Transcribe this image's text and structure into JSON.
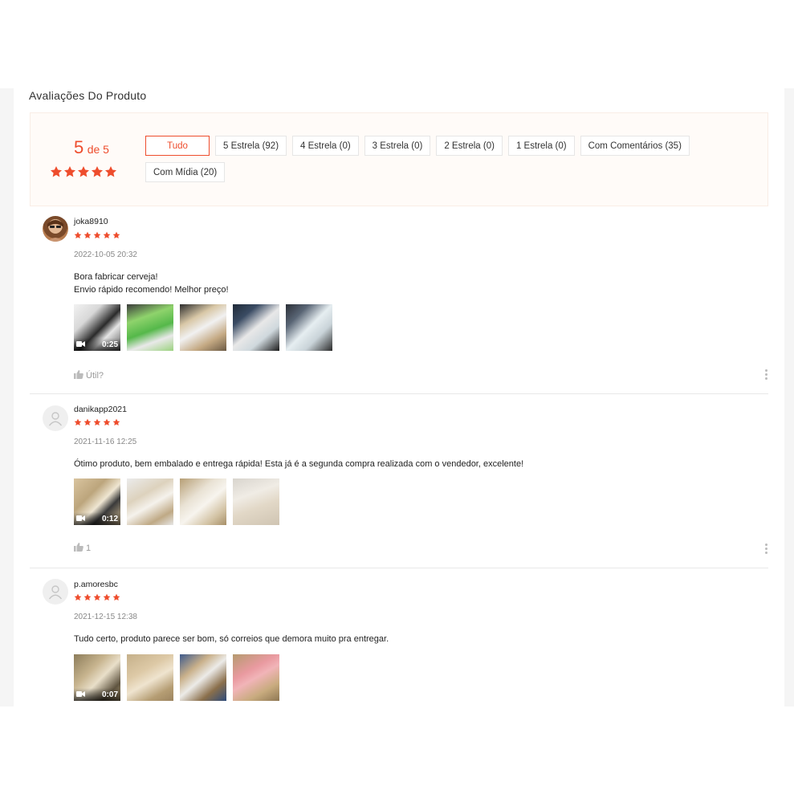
{
  "section_title": "Avaliações Do Produto",
  "summary": {
    "score": "5",
    "of_text": "de 5",
    "rating": 5
  },
  "filters": [
    "Tudo",
    "5 Estrela (92)",
    "4 Estrela (0)",
    "3 Estrela (0)",
    "2 Estrela (0)",
    "1 Estrela (0)",
    "Com Comentários (35)",
    "Com Mídia (20)"
  ],
  "accent_color": "#ee4d2d",
  "reviews": [
    {
      "username": "joka8910",
      "rating": 5,
      "date": "2022-10-05 20:32",
      "comment_lines": [
        "Bora fabricar cerveja!",
        "Envio rápido recomendo! Melhor preço!"
      ],
      "video_duration": "0:25",
      "helpful_label": "Útil?"
    },
    {
      "username": "danikapp2021",
      "rating": 5,
      "date": "2021-11-16 12:25",
      "comment_lines": [
        "Ótimo produto, bem embalado e entrega rápida! Esta já é a segunda compra realizada com o vendedor, excelente!"
      ],
      "video_duration": "0:12",
      "helpful_label": "1"
    },
    {
      "username": "p.amoresbc",
      "rating": 5,
      "date": "2021-12-15 12:38",
      "comment_lines": [
        "Tudo certo, produto parece ser bom, só correios que demora muito pra entregar."
      ],
      "video_duration": "0:07"
    }
  ]
}
